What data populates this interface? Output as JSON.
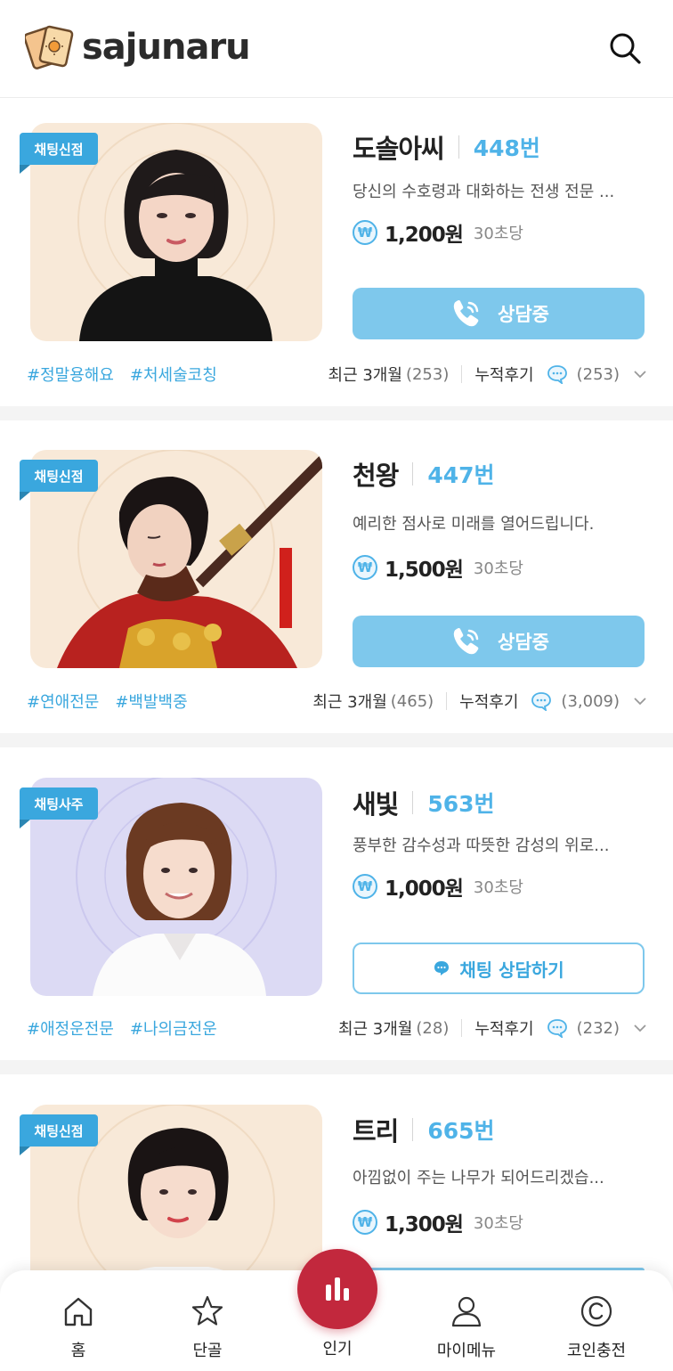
{
  "header": {
    "logo_text": "sajunaru"
  },
  "cards": [
    {
      "badge": "채팅신점",
      "name": "도솔아씨",
      "number": "448번",
      "description": "당신의 수호령과 대화하는 전생 전문 ...",
      "price": "1,200원",
      "per": "30초당",
      "button": "상담중",
      "tags": [
        "#정말용해요",
        "#처세술코칭"
      ],
      "recent_label": "최근 3개월",
      "recent_count": "(253)",
      "review_label": "누적후기",
      "review_count": "(253)"
    },
    {
      "badge": "채팅신점",
      "name": "천왕",
      "number": "447번",
      "description": "예리한 점사로 미래를 열어드립니다.",
      "price": "1,500원",
      "per": "30초당",
      "button": "상담중",
      "tags": [
        "#연애전문",
        "#백발백중"
      ],
      "recent_label": "최근 3개월",
      "recent_count": "(465)",
      "review_label": "누적후기",
      "review_count": "(3,009)"
    },
    {
      "badge": "채팅사주",
      "name": "새빛",
      "number": "563번",
      "description": "풍부한 감수성과 따뜻한 감성의 위로...",
      "price": "1,000원",
      "per": "30초당",
      "button": "채팅 상담하기",
      "tags": [
        "#애정운전문",
        "#나의금전운"
      ],
      "recent_label": "최근 3개월",
      "recent_count": "(28)",
      "review_label": "누적후기",
      "review_count": "(232)"
    },
    {
      "badge": "채팅신점",
      "name": "트리",
      "number": "665번",
      "description": "아낌없이 주는 나무가 되어드리겠습...",
      "price": "1,300원",
      "per": "30초당"
    }
  ],
  "won_symbol": "₩",
  "nav": {
    "home": "홈",
    "favorite": "단골",
    "popular": "인기",
    "mymenu": "마이메뉴",
    "coin": "코인충전"
  },
  "colors": {
    "accent": "#3aa7de",
    "button_fill": "#7ec8ec",
    "center_button": "#c2283d",
    "photo_bg_warm": "#f8e9d8",
    "photo_bg_lavender": "#dcdaf4"
  }
}
